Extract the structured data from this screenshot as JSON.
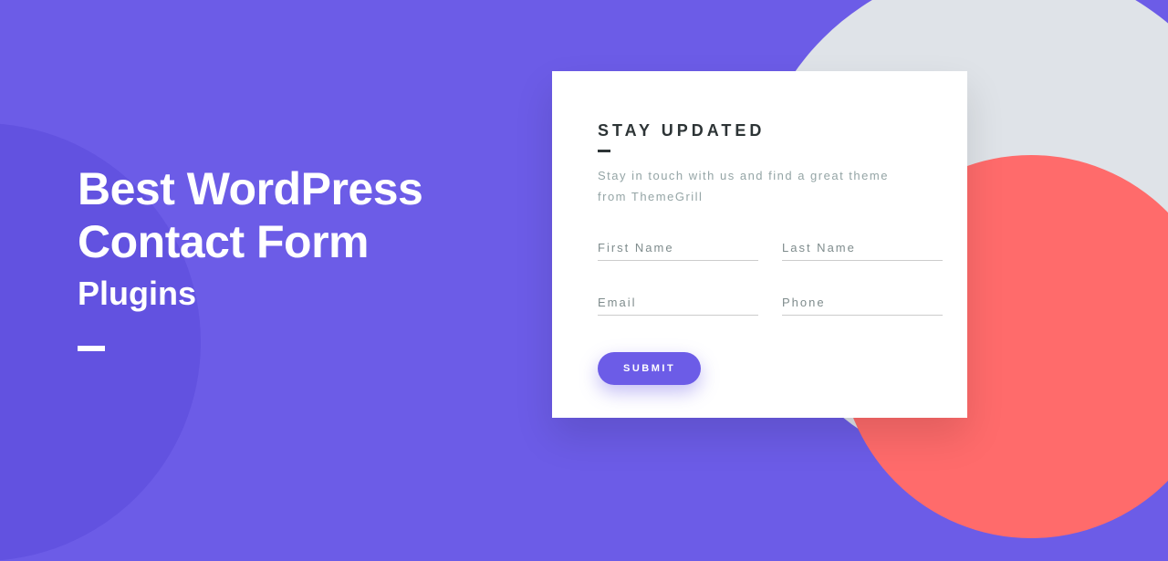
{
  "hero": {
    "line1": "Best WordPress",
    "line2": "Contact Form",
    "line3": "Plugins"
  },
  "card": {
    "title": "STAY UPDATED",
    "description": "Stay in touch with us and find a great theme from ThemeGrill",
    "fields": {
      "firstName": {
        "placeholder": "First Name",
        "value": ""
      },
      "lastName": {
        "placeholder": "Last Name",
        "value": ""
      },
      "email": {
        "placeholder": "Email",
        "value": ""
      },
      "phone": {
        "placeholder": "Phone",
        "value": ""
      }
    },
    "submit": "SUBMIT"
  },
  "colors": {
    "primary": "#6c5ce7",
    "coral": "#ff6b6b",
    "grey": "#dfe3e8"
  }
}
